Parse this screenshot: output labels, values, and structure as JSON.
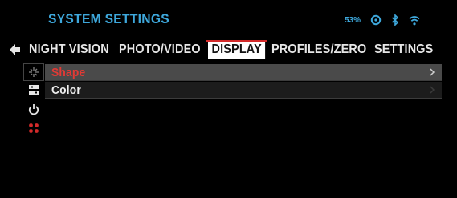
{
  "header": {
    "title": "SYSTEM SETTINGS",
    "battery_label": "53%",
    "status_icons": [
      "battery-icon",
      "bluetooth-icon",
      "wifi-icon"
    ]
  },
  "tabs": [
    {
      "label": "NIGHT VISION",
      "active": false
    },
    {
      "label": "PHOTO/VIDEO",
      "active": false
    },
    {
      "label": "DISPLAY",
      "active": true
    },
    {
      "label": "PROFILES/ZERO",
      "active": false
    },
    {
      "label": "SETTINGS",
      "active": false
    }
  ],
  "sidebar": {
    "items": [
      {
        "icon": "reticle-shape-icon",
        "selected": true
      },
      {
        "icon": "color-palette-icon",
        "selected": false
      },
      {
        "icon": "power-icon",
        "selected": false
      },
      {
        "icon": "dots-grid-icon",
        "selected": false
      }
    ]
  },
  "menu": {
    "rows": [
      {
        "label": "Shape",
        "highlighted": true
      },
      {
        "label": "Color",
        "highlighted": false
      }
    ]
  },
  "colors": {
    "accent_blue": "#3ea8dc",
    "accent_red": "#e23a35",
    "background": "#000000"
  }
}
